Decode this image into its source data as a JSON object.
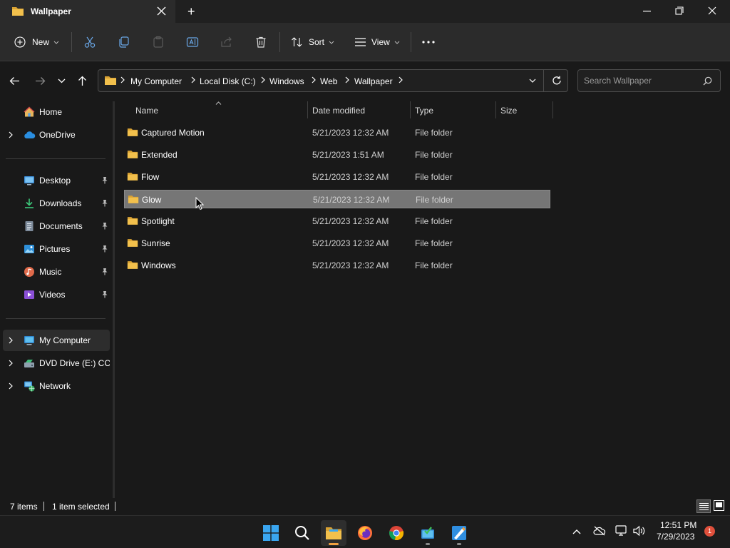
{
  "window": {
    "tab_title": "Wallpaper",
    "new_tab_symbol": "+"
  },
  "toolbar": {
    "new_label": "New",
    "sort_label": "Sort",
    "view_label": "View"
  },
  "address": {
    "crumbs": [
      "My Computer",
      "Local Disk (C:)",
      "Windows",
      "Web",
      "Wallpaper"
    ],
    "search_placeholder": "Search Wallpaper"
  },
  "sidebar": {
    "home": "Home",
    "onedrive": "OneDrive",
    "quick": [
      {
        "label": "Desktop",
        "icon": "desktop-icon"
      },
      {
        "label": "Downloads",
        "icon": "downloads-icon"
      },
      {
        "label": "Documents",
        "icon": "documents-icon"
      },
      {
        "label": "Pictures",
        "icon": "pictures-icon"
      },
      {
        "label": "Music",
        "icon": "music-icon"
      },
      {
        "label": "Videos",
        "icon": "videos-icon"
      }
    ],
    "my_computer": "My Computer",
    "dvd": "DVD Drive (E:) CCC",
    "network": "Network"
  },
  "columns": {
    "name": "Name",
    "date": "Date modified",
    "type": "Type",
    "size": "Size"
  },
  "files": [
    {
      "name": "Captured Motion",
      "date": "5/21/2023 12:32 AM",
      "type": "File folder",
      "selected": false
    },
    {
      "name": "Extended",
      "date": "5/21/2023 1:51 AM",
      "type": "File folder",
      "selected": false
    },
    {
      "name": "Flow",
      "date": "5/21/2023 12:32 AM",
      "type": "File folder",
      "selected": false
    },
    {
      "name": "Glow",
      "date": "5/21/2023 12:32 AM",
      "type": "File folder",
      "selected": true
    },
    {
      "name": "Spotlight",
      "date": "5/21/2023 12:32 AM",
      "type": "File folder",
      "selected": false
    },
    {
      "name": "Sunrise",
      "date": "5/21/2023 12:32 AM",
      "type": "File folder",
      "selected": false
    },
    {
      "name": "Windows",
      "date": "5/21/2023 12:32 AM",
      "type": "File folder",
      "selected": false
    }
  ],
  "status": {
    "items": "7 items",
    "selected": "1 item selected"
  },
  "taskbar": {
    "time": "12:51 PM",
    "date": "7/29/2023",
    "notification_count": "1"
  },
  "colors": {
    "folder": "#f2c04c",
    "folder_dark": "#d9a233",
    "accent": "#f0a040",
    "selection": "#767676",
    "notification": "#e0503c"
  }
}
